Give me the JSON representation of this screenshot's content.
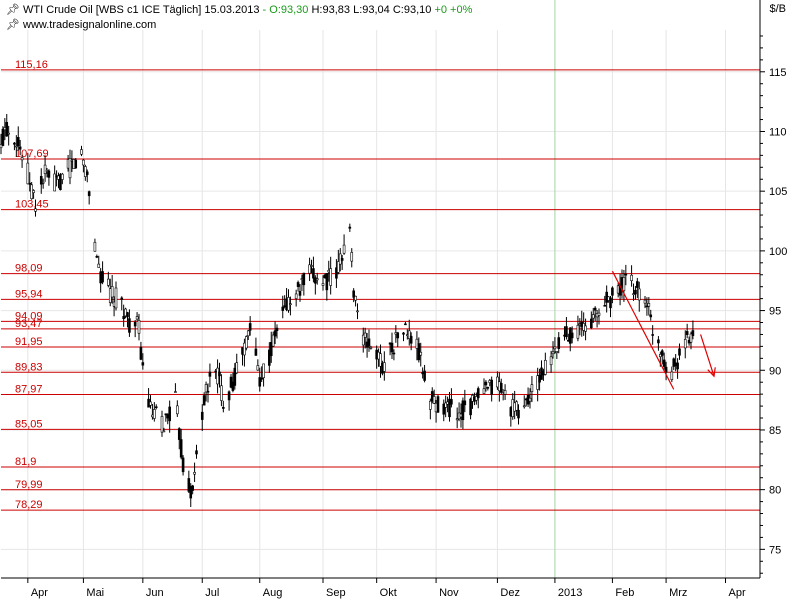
{
  "header": {
    "symbol": "WTI Crude Oil",
    "source": "[WBS c1 ICE",
    "interval": "Täglich]",
    "date": "15.03.2013",
    "open": "O:93,30",
    "high": "H:93,83",
    "low": "L:93,04",
    "close": "C:93,10",
    "change": "+0",
    "change_pct": "+0%",
    "website": "www.tradesignalonline.com"
  },
  "colors": {
    "candle": "#000000",
    "hline": "#cc0000",
    "hline_label": "#cc0000",
    "grid": "#e6e6e6",
    "year_marker": "#a8d8a8",
    "trend_arrow": "#e00000"
  },
  "chart_data": {
    "type": "candlestick",
    "title": "WTI Crude Oil",
    "ylabel": "$/B",
    "ylim": [
      72.6,
      118.5
    ],
    "y_ticks": [
      75,
      80,
      85,
      90,
      95,
      100,
      105,
      110,
      115
    ],
    "x_tick_labels": [
      "Apr",
      "Mai",
      "Jun",
      "Jul",
      "Aug",
      "Sep",
      "Okt",
      "Nov",
      "Dez",
      "2013",
      "Feb",
      "Mrz",
      "Apr"
    ],
    "x_range": [
      "2012-03-19",
      "2013-04-19"
    ],
    "x_ticks": [
      "2012-04-02",
      "2012-05-01",
      "2012-06-01",
      "2012-07-02",
      "2012-08-01",
      "2012-09-03",
      "2012-10-01",
      "2012-11-01",
      "2012-12-03",
      "2013-01-02",
      "2013-02-01",
      "2013-03-01",
      "2013-04-01"
    ],
    "year_marker": "2013-01-02",
    "grid": true,
    "levels": [
      {
        "value": 115.16,
        "label": "115,16"
      },
      {
        "value": 107.69,
        "label": "107,69"
      },
      {
        "value": 103.45,
        "label": "103,45"
      },
      {
        "value": 98.09,
        "label": "98,09"
      },
      {
        "value": 95.94,
        "label": "95,94"
      },
      {
        "value": 94.09,
        "label": "94,09"
      },
      {
        "value": 93.47,
        "label": "93,47"
      },
      {
        "value": 91.95,
        "label": "91,95"
      },
      {
        "value": 89.83,
        "label": "89,83"
      },
      {
        "value": 87.97,
        "label": "87,97"
      },
      {
        "value": 85.05,
        "label": "85,05"
      },
      {
        "value": 81.9,
        "label": "81,9"
      },
      {
        "value": 79.99,
        "label": "79,99"
      },
      {
        "value": 78.29,
        "label": "78,29"
      }
    ],
    "price_path": [
      [
        "2012-03-19",
        108.5
      ],
      [
        "2012-03-21",
        110.5
      ],
      [
        "2012-03-27",
        109.5
      ],
      [
        "2012-04-02",
        106.5
      ],
      [
        "2012-04-06",
        104.0
      ],
      [
        "2012-04-11",
        106.5
      ],
      [
        "2012-04-17",
        105.5
      ],
      [
        "2012-04-24",
        107.0
      ],
      [
        "2012-04-30",
        108.0
      ],
      [
        "2012-05-03",
        106.5
      ],
      [
        "2012-05-07",
        100.5
      ],
      [
        "2012-05-10",
        98.0
      ],
      [
        "2012-05-15",
        96.5
      ],
      [
        "2012-05-21",
        95.5
      ],
      [
        "2012-05-25",
        94.0
      ],
      [
        "2012-05-30",
        93.5
      ],
      [
        "2012-06-01",
        90.0
      ],
      [
        "2012-06-05",
        86.5
      ],
      [
        "2012-06-12",
        85.5
      ],
      [
        "2012-06-18",
        87.5
      ],
      [
        "2012-06-22",
        82.0
      ],
      [
        "2012-06-27",
        79.5
      ],
      [
        "2012-06-29",
        83.0
      ],
      [
        "2012-07-03",
        87.5
      ],
      [
        "2012-07-09",
        90.5
      ],
      [
        "2012-07-13",
        87.5
      ],
      [
        "2012-07-18",
        89.0
      ],
      [
        "2012-07-24",
        92.0
      ],
      [
        "2012-07-27",
        93.5
      ],
      [
        "2012-08-01",
        89.5
      ],
      [
        "2012-08-06",
        91.0
      ],
      [
        "2012-08-10",
        93.5
      ],
      [
        "2012-08-15",
        95.5
      ],
      [
        "2012-08-21",
        96.5
      ],
      [
        "2012-08-27",
        98.0
      ],
      [
        "2012-09-04",
        97.5
      ],
      [
        "2012-09-10",
        98.0
      ],
      [
        "2012-09-13",
        100.0
      ],
      [
        "2012-09-17",
        101.5
      ],
      [
        "2012-09-19",
        97.0
      ],
      [
        "2012-09-24",
        92.5
      ],
      [
        "2012-09-28",
        92.0
      ],
      [
        "2012-10-04",
        90.5
      ],
      [
        "2012-10-09",
        92.0
      ],
      [
        "2012-10-15",
        93.5
      ],
      [
        "2012-10-22",
        92.0
      ],
      [
        "2012-10-29",
        87.5
      ],
      [
        "2012-11-05",
        87.0
      ],
      [
        "2012-11-12",
        86.5
      ],
      [
        "2012-11-19",
        87.0
      ],
      [
        "2012-11-26",
        88.0
      ],
      [
        "2012-12-03",
        89.0
      ],
      [
        "2012-12-10",
        87.0
      ],
      [
        "2012-12-14",
        86.5
      ],
      [
        "2012-12-19",
        87.5
      ],
      [
        "2012-12-24",
        89.0
      ],
      [
        "2013-01-02",
        91.5
      ],
      [
        "2013-01-08",
        93.0
      ],
      [
        "2013-01-16",
        93.5
      ],
      [
        "2013-01-23",
        94.5
      ],
      [
        "2013-01-30",
        96.0
      ],
      [
        "2013-02-04",
        96.5
      ],
      [
        "2013-02-08",
        97.5
      ],
      [
        "2013-02-12",
        97.0
      ],
      [
        "2013-02-19",
        96.0
      ],
      [
        "2013-02-21",
        94.0
      ],
      [
        "2013-02-26",
        92.0
      ],
      [
        "2013-03-01",
        90.5
      ],
      [
        "2013-03-04",
        90.0
      ],
      [
        "2013-03-06",
        90.5
      ],
      [
        "2013-03-08",
        91.5
      ],
      [
        "2013-03-12",
        92.5
      ],
      [
        "2013-03-15",
        93.1
      ]
    ],
    "trend_line": [
      [
        "2013-02-01",
        98.3
      ],
      [
        "2013-03-05",
        88.4
      ]
    ],
    "forecast_arrow": [
      [
        "2013-03-19",
        93.0
      ],
      [
        "2013-03-26",
        89.5
      ]
    ]
  }
}
